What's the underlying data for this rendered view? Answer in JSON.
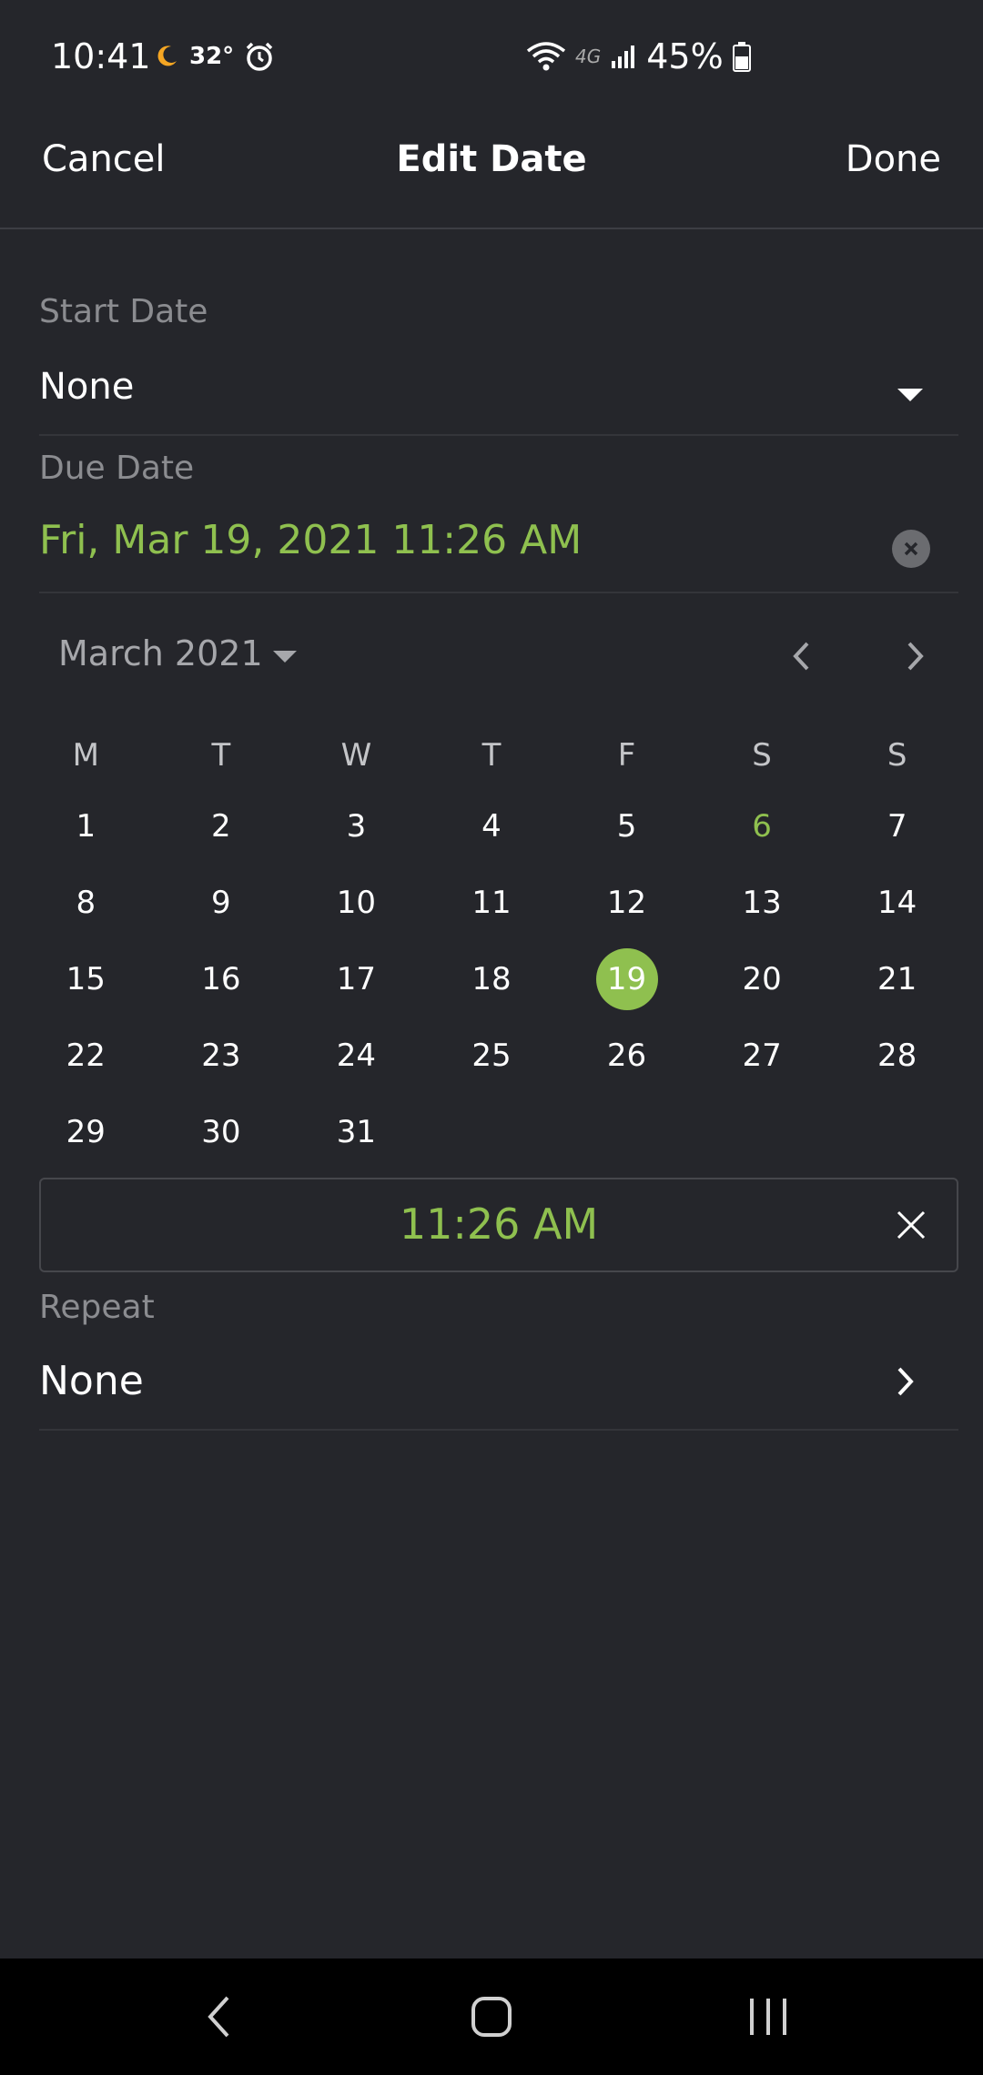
{
  "status": {
    "time": "10:41",
    "temperature": "32°",
    "network": "4G",
    "battery": "45%"
  },
  "header": {
    "cancel_label": "Cancel",
    "title": "Edit Date",
    "done_label": "Done"
  },
  "start_date": {
    "label": "Start Date",
    "value": "None"
  },
  "due_date": {
    "label": "Due Date",
    "value": "Fri, Mar 19, 2021 11:26 AM"
  },
  "calendar": {
    "month_label": "March 2021",
    "weekdays": [
      "M",
      "T",
      "W",
      "T",
      "F",
      "S",
      "S"
    ],
    "weeks": [
      [
        "1",
        "2",
        "3",
        "4",
        "5",
        "6",
        "7"
      ],
      [
        "8",
        "9",
        "10",
        "11",
        "12",
        "13",
        "14"
      ],
      [
        "15",
        "16",
        "17",
        "18",
        "19",
        "20",
        "21"
      ],
      [
        "22",
        "23",
        "24",
        "25",
        "26",
        "27",
        "28"
      ],
      [
        "29",
        "30",
        "31",
        "",
        "",
        "",
        ""
      ]
    ],
    "selected_day": "19",
    "highlighted_day": "6"
  },
  "time": {
    "value": "11:26 AM"
  },
  "repeat": {
    "label": "Repeat",
    "value": "None"
  },
  "colors": {
    "accent": "#8fc04f",
    "background": "#25262b",
    "muted_text": "#8b8c90"
  }
}
